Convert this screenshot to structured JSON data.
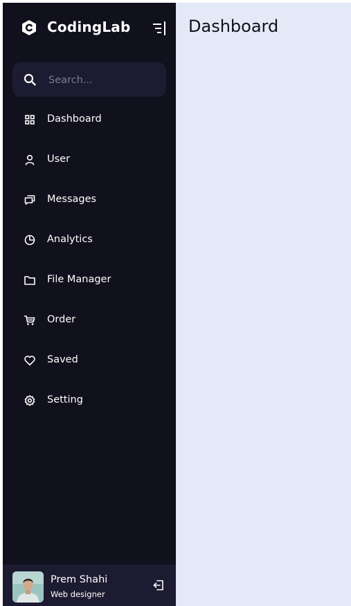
{
  "brand": {
    "name": "CodingLab",
    "logo_icon": "logo-c-icon"
  },
  "search": {
    "placeholder": "Search..."
  },
  "nav": [
    {
      "label": "Dashboard",
      "icon": "grid-icon"
    },
    {
      "label": "User",
      "icon": "user-icon"
    },
    {
      "label": "Messages",
      "icon": "chat-icon"
    },
    {
      "label": "Analytics",
      "icon": "pie-chart-icon"
    },
    {
      "label": "File Manager",
      "icon": "folder-icon"
    },
    {
      "label": "Order",
      "icon": "cart-icon"
    },
    {
      "label": "Saved",
      "icon": "heart-icon"
    },
    {
      "label": "Setting",
      "icon": "gear-icon"
    }
  ],
  "profile": {
    "name": "Prem Shahi",
    "job": "Web designer"
  },
  "main": {
    "title": "Dashboard"
  },
  "colors": {
    "sidebar": "#11101d",
    "sidebar_alt": "#1d1b31",
    "content": "#e4e9f7",
    "text": "#ffffff"
  }
}
